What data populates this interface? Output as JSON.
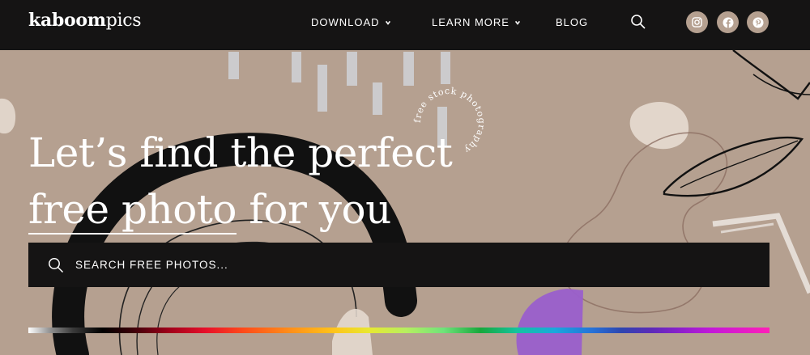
{
  "brand": {
    "logo_bold": "kaboom",
    "logo_light": "pics"
  },
  "nav": {
    "items": [
      {
        "label": "DOWNLOAD",
        "has_dropdown": true
      },
      {
        "label": "LEARN MORE",
        "has_dropdown": true
      },
      {
        "label": "BLOG",
        "has_dropdown": false
      }
    ],
    "search_icon": "search-icon",
    "social": [
      {
        "name": "instagram",
        "icon": "instagram-icon"
      },
      {
        "name": "facebook",
        "icon": "facebook-icon"
      },
      {
        "name": "pinterest",
        "icon": "pinterest-icon"
      }
    ]
  },
  "hero": {
    "headline_line1": "Let’s find the perfect",
    "headline_line2_underlined": "free photo",
    "headline_line2_rest": " for you",
    "badge_text": "free stock photography",
    "search_placeholder": "SEARCH FREE PHOTOS...",
    "background_color": "#b5a090"
  },
  "colors": {
    "header_bg": "#151414",
    "accent_beige": "#b5a090",
    "text_white": "#ffffff"
  }
}
